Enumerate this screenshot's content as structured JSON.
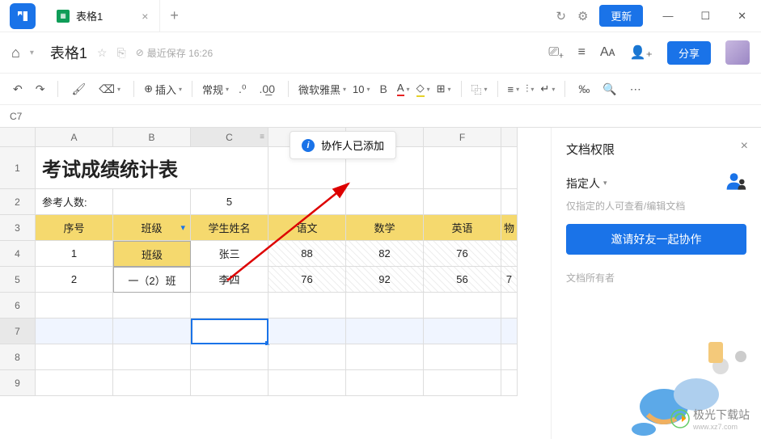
{
  "titlebar": {
    "tab_title": "表格1",
    "update_label": "更新"
  },
  "docheader": {
    "title": "表格1",
    "save_info": "最近保存 16:26",
    "share_label": "分享"
  },
  "toolbar": {
    "insert": "插入",
    "format": "常规",
    "font": "微软雅黑",
    "size": "10",
    "bold": "B",
    "underline_a": "A",
    "fill": "⬚"
  },
  "namebox": "C7",
  "columns": [
    "A",
    "B",
    "C",
    "D",
    "E",
    "F"
  ],
  "rows": [
    "1",
    "2",
    "3",
    "4",
    "5",
    "6",
    "7",
    "8",
    "9"
  ],
  "sheet": {
    "title": "考试成绩统计表",
    "label_count": "参考人数:",
    "count_value": "5",
    "headers": [
      "序号",
      "班级",
      "学生姓名",
      "语文",
      "数学",
      "英语",
      "物"
    ],
    "filter_header": "班级",
    "r4": [
      "1",
      "班级",
      "张三",
      "88",
      "82",
      "76",
      ""
    ],
    "r5": [
      "2",
      "一（2）班",
      "李四",
      "76",
      "92",
      "56",
      "7"
    ]
  },
  "toast": "协作人已添加",
  "panel": {
    "title": "文档权限",
    "perm_label": "指定人",
    "perm_desc": "仅指定的人可查看/编辑文档",
    "invite": "邀请好友一起协作",
    "owner": "文档所有者"
  },
  "watermark": "极光下载站",
  "watermark_url": "www.xz7.com"
}
